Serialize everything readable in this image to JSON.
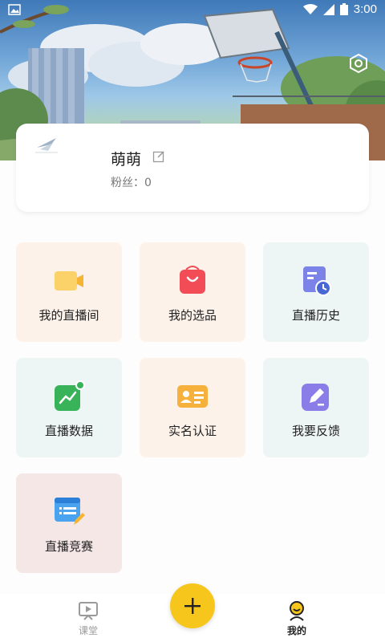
{
  "status_bar": {
    "time": "3:00"
  },
  "profile": {
    "name": "萌萌",
    "fans_label": "粉丝：0"
  },
  "menu": [
    {
      "label": "我的直播间",
      "icon": "video-camera-icon"
    },
    {
      "label": "我的选品",
      "icon": "shopping-bag-icon"
    },
    {
      "label": "直播历史",
      "icon": "history-clock-icon"
    },
    {
      "label": "直播数据",
      "icon": "data-chart-icon"
    },
    {
      "label": "实名认证",
      "icon": "id-card-icon"
    },
    {
      "label": "我要反馈",
      "icon": "feedback-pencil-icon"
    },
    {
      "label": "直播竞赛",
      "icon": "contest-document-icon"
    }
  ],
  "tabbar": {
    "course_label": "课堂",
    "mine_label": "我的",
    "fab_symbol": "+"
  },
  "colors": {
    "accent": "#f7c61c",
    "tile_orange": "#fdf2ea",
    "tile_mint": "#eef6f5",
    "tile_pink": "#f6e7e7"
  }
}
